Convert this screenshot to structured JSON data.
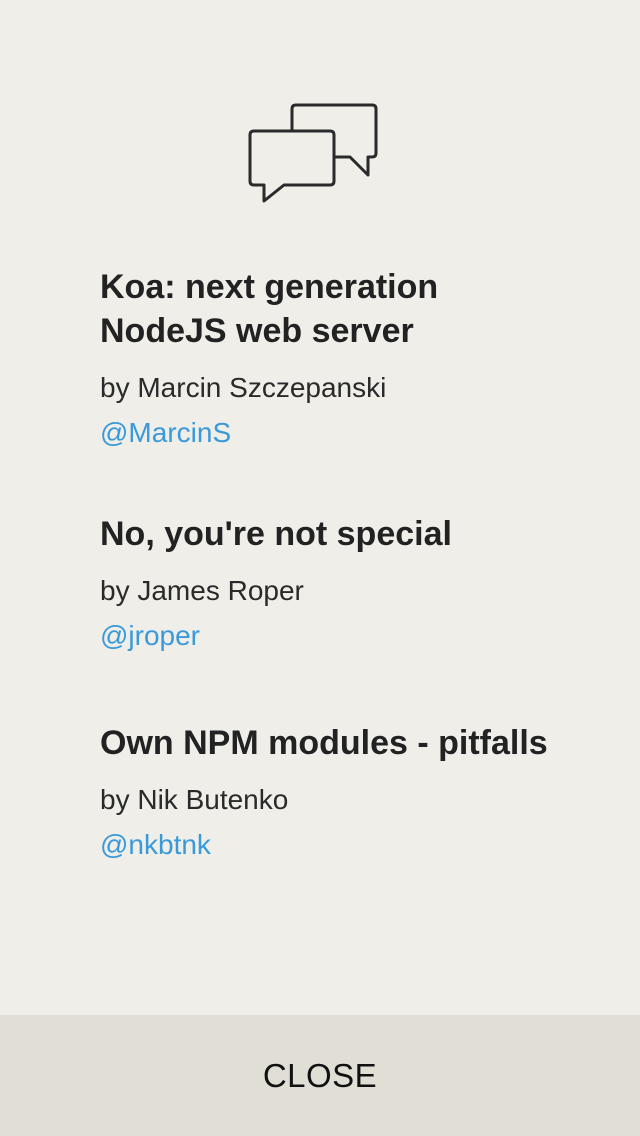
{
  "talks": [
    {
      "title": "Koa: next generation NodeJS web server",
      "author": "by Marcin Szczepanski",
      "handle": "@MarcinS"
    },
    {
      "title": "No, you're not special",
      "author": "by James Roper",
      "handle": "@jroper"
    },
    {
      "title": "Own NPM modules - pitfalls",
      "author": "by Nik Butenko",
      "handle": "@nkbtnk"
    }
  ],
  "close_label": "CLOSE",
  "icons": {
    "header": "chat-bubbles-icon"
  },
  "colors": {
    "background": "#efeee9",
    "link": "#3a9ad9",
    "close_bar": "#e1dfd5"
  }
}
